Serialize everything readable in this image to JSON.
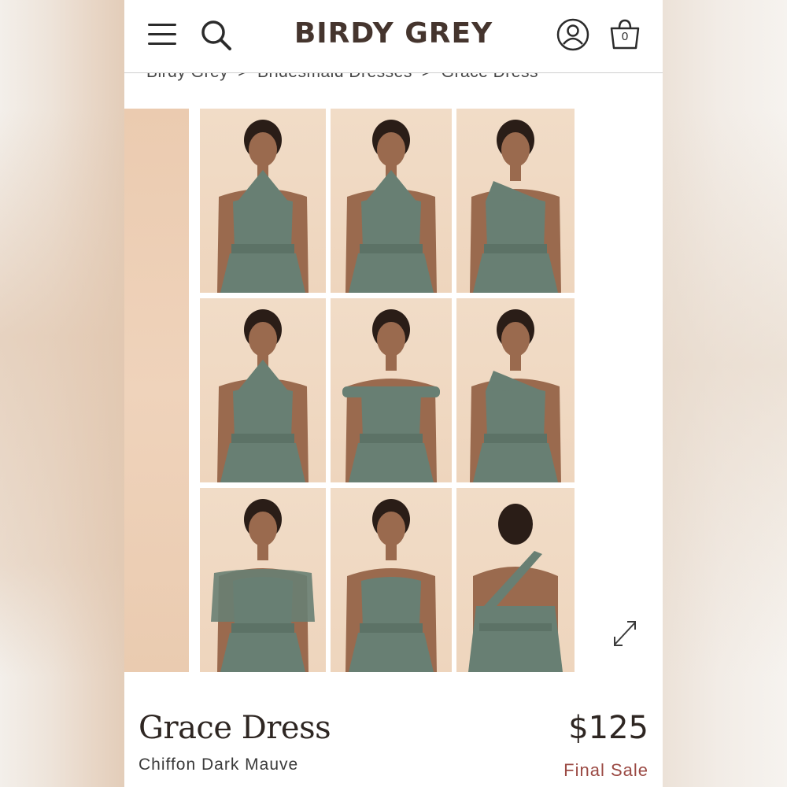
{
  "header": {
    "logo": "BIRDY GREY",
    "bag_count": "0"
  },
  "breadcrumb": {
    "items": [
      "Birdy Grey",
      "Bridesmaid Dresses",
      "Grace Dress"
    ],
    "separator": ">"
  },
  "gallery": {
    "styles": [
      "criss-cross-halter",
      "twisted-halter",
      "one-shoulder-sweetheart",
      "halter-v",
      "off-the-shoulder",
      "one-shoulder-drape",
      "flutter-sleeve",
      "strapless-sweetheart",
      "one-shoulder-back"
    ]
  },
  "product": {
    "name": "Grace Dress",
    "variant": "Chiffon Dark Mauve",
    "price": "$125",
    "sale_label": "Final Sale"
  },
  "colors": {
    "logo": "#45352e",
    "dress": "#687f73",
    "backdrop": "#efd7c0",
    "sale": "#9b4a44"
  }
}
